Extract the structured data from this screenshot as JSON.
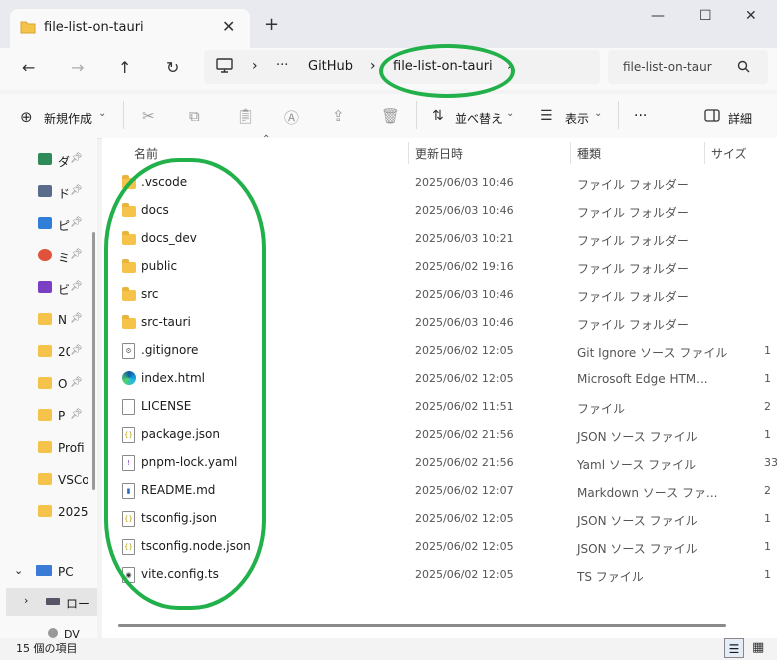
{
  "window": {
    "tab_title": "file-list-on-tauri",
    "tab_close": "✕",
    "new_tab": "+",
    "minimize": "—",
    "maximize": "☐",
    "close": "✕"
  },
  "nav": {
    "back": "←",
    "forward": "→",
    "up": "↑",
    "refresh": "↻",
    "crumb_ellipsis": "···",
    "crumbs": [
      "GitHub",
      "file-list-on-tauri"
    ],
    "chevron": "›",
    "search_placeholder": "file-list-on-taur"
  },
  "toolbar": {
    "new_label": "新規作成",
    "sort_label": "並べ替え",
    "view_label": "表示",
    "more_label": "···",
    "details_label": "詳細"
  },
  "sidebar": {
    "items": [
      {
        "label": "ダ",
        "icon": "download-icon",
        "color": "#2e8b57"
      },
      {
        "label": "ド",
        "icon": "document-icon",
        "color": "#5a6b8c"
      },
      {
        "label": "ピ",
        "icon": "picture-icon",
        "color": "#2f7fd8"
      },
      {
        "label": "ミ",
        "icon": "music-icon",
        "color": "#e0533a"
      },
      {
        "label": "ビ",
        "icon": "video-icon",
        "color": "#7b3fc4"
      },
      {
        "label": "N",
        "icon": "folder-icon",
        "color": "#f5c24a"
      },
      {
        "label": "20",
        "icon": "folder-icon",
        "color": "#f5c24a"
      },
      {
        "label": "O",
        "icon": "folder-icon",
        "color": "#f5c24a"
      },
      {
        "label": "P",
        "icon": "folder-icon",
        "color": "#f5c24a"
      },
      {
        "label": "Profi",
        "icon": "folder-icon",
        "color": "#f5c24a"
      },
      {
        "label": "VSCo",
        "icon": "folder-icon",
        "color": "#f5c24a"
      },
      {
        "label": "2025",
        "icon": "folder-icon",
        "color": "#f5c24a"
      }
    ],
    "pc_label": "PC",
    "local_label": "ロー",
    "dv_label": "DV"
  },
  "columns": {
    "name": "名前",
    "date": "更新日時",
    "type": "種類",
    "size": "サイズ"
  },
  "files": [
    {
      "name": ".vscode",
      "date": "2025/06/03 10:46",
      "type": "ファイル フォルダー",
      "size": "",
      "kind": "folder"
    },
    {
      "name": "docs",
      "date": "2025/06/03 10:46",
      "type": "ファイル フォルダー",
      "size": "",
      "kind": "folder"
    },
    {
      "name": "docs_dev",
      "date": "2025/06/03 10:21",
      "type": "ファイル フォルダー",
      "size": "",
      "kind": "folder"
    },
    {
      "name": "public",
      "date": "2025/06/02 19:16",
      "type": "ファイル フォルダー",
      "size": "",
      "kind": "folder"
    },
    {
      "name": "src",
      "date": "2025/06/03 10:46",
      "type": "ファイル フォルダー",
      "size": "",
      "kind": "folder"
    },
    {
      "name": "src-tauri",
      "date": "2025/06/03 10:46",
      "type": "ファイル フォルダー",
      "size": "",
      "kind": "folder"
    },
    {
      "name": ".gitignore",
      "date": "2025/06/02 12:05",
      "type": "Git Ignore ソース ファイル",
      "size": "1",
      "kind": "gear"
    },
    {
      "name": "index.html",
      "date": "2025/06/02 12:05",
      "type": "Microsoft Edge HTM...",
      "size": "1",
      "kind": "edge"
    },
    {
      "name": "LICENSE",
      "date": "2025/06/02 11:51",
      "type": "ファイル",
      "size": "2",
      "kind": "file"
    },
    {
      "name": "package.json",
      "date": "2025/06/02 21:56",
      "type": "JSON ソース ファイル",
      "size": "1",
      "kind": "json"
    },
    {
      "name": "pnpm-lock.yaml",
      "date": "2025/06/02 21:56",
      "type": "Yaml ソース ファイル",
      "size": "33",
      "kind": "yaml"
    },
    {
      "name": "README.md",
      "date": "2025/06/02 12:07",
      "type": "Markdown ソース ファ...",
      "size": "2",
      "kind": "md"
    },
    {
      "name": "tsconfig.json",
      "date": "2025/06/02 12:05",
      "type": "JSON ソース ファイル",
      "size": "1",
      "kind": "json"
    },
    {
      "name": "tsconfig.node.json",
      "date": "2025/06/02 12:05",
      "type": "JSON ソース ファイル",
      "size": "1",
      "kind": "json"
    },
    {
      "name": "vite.config.ts",
      "date": "2025/06/02 12:05",
      "type": "TS ファイル",
      "size": "1",
      "kind": "ts"
    }
  ],
  "status": {
    "item_count": "15 個の項目"
  },
  "colors": {
    "annotation": "#22b04a",
    "folder": "#f5c24a",
    "accent": "#0067c0"
  }
}
